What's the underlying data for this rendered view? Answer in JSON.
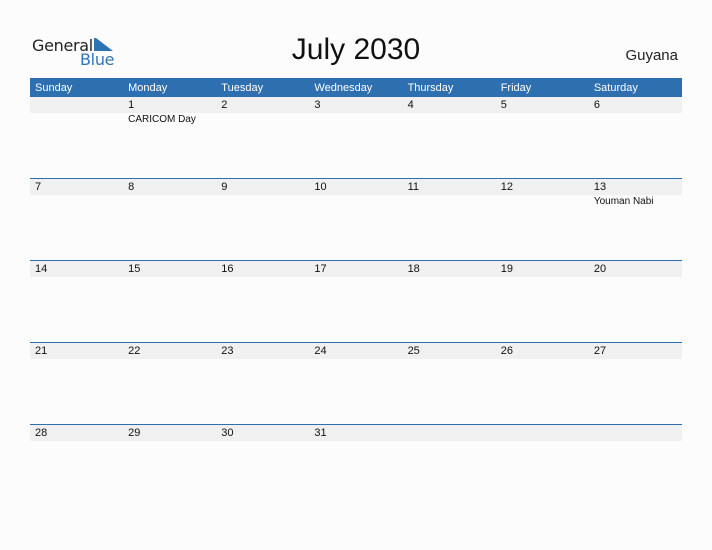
{
  "logo": {
    "word1": "General",
    "word2": "Blue",
    "brand_color": "#2e74b5"
  },
  "title": "July 2030",
  "country": "Guyana",
  "colors": {
    "header_bg": "#2e6fb0",
    "date_row_bg": "#f0f0f0"
  },
  "weekdays": [
    "Sunday",
    "Monday",
    "Tuesday",
    "Wednesday",
    "Thursday",
    "Friday",
    "Saturday"
  ],
  "weeks": [
    {
      "dates": [
        "",
        "1",
        "2",
        "3",
        "4",
        "5",
        "6"
      ],
      "events": [
        "",
        "CARICOM Day",
        "",
        "",
        "",
        "",
        ""
      ]
    },
    {
      "dates": [
        "7",
        "8",
        "9",
        "10",
        "11",
        "12",
        "13"
      ],
      "events": [
        "",
        "",
        "",
        "",
        "",
        "",
        "Youman Nabi"
      ]
    },
    {
      "dates": [
        "14",
        "15",
        "16",
        "17",
        "18",
        "19",
        "20"
      ],
      "events": [
        "",
        "",
        "",
        "",
        "",
        "",
        ""
      ]
    },
    {
      "dates": [
        "21",
        "22",
        "23",
        "24",
        "25",
        "26",
        "27"
      ],
      "events": [
        "",
        "",
        "",
        "",
        "",
        "",
        ""
      ]
    },
    {
      "dates": [
        "28",
        "29",
        "30",
        "31",
        "",
        "",
        ""
      ],
      "events": [
        "",
        "",
        "",
        "",
        "",
        "",
        ""
      ]
    }
  ]
}
